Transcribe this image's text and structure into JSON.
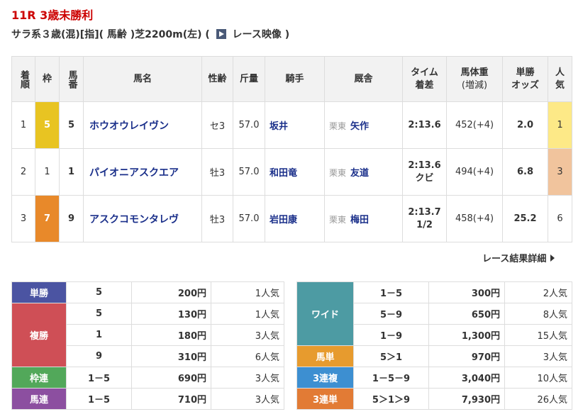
{
  "race": {
    "title": "11R 3歳未勝利",
    "info_prefix": "サラ系３歳(混)[指](",
    "info_weight": "馬齢",
    "info_suffix": ")芝2200m(左)",
    "video_open": "(",
    "video_label": "レース映像",
    "video_close": ")"
  },
  "results_table": {
    "headers": {
      "rank": "着順",
      "frame": "枠",
      "horse_no": "馬番",
      "name": "馬名",
      "sex_age": "性齢",
      "weight": "斤量",
      "jockey": "騎手",
      "trainer": "厩舎",
      "time_line1": "タイム",
      "time_line2": "着差",
      "body_line1": "馬体重",
      "body_line2": "(増減)",
      "odds_line1": "単勝",
      "odds_line2": "オッズ",
      "pop_line1": "人",
      "pop_line2": "気"
    },
    "rows": [
      {
        "rank": "1",
        "frame": "5",
        "horse_no": "5",
        "name": "ホウオウレイヴン",
        "sex_age": "セ3",
        "weight": "57.0",
        "jockey": "坂井",
        "area": "栗東",
        "trainer": "矢作",
        "time": "2:13.6",
        "margin": "",
        "body": "452(+4)",
        "odds": "2.0",
        "pop": "1"
      },
      {
        "rank": "2",
        "frame": "1",
        "horse_no": "1",
        "name": "パイオニアスクエア",
        "sex_age": "牡3",
        "weight": "57.0",
        "jockey": "和田竜",
        "area": "栗東",
        "trainer": "友道",
        "time": "2:13.6",
        "margin": "クビ",
        "body": "494(+4)",
        "odds": "6.8",
        "pop": "3"
      },
      {
        "rank": "3",
        "frame": "7",
        "horse_no": "9",
        "name": "アスクコモンタレヴ",
        "sex_age": "牡3",
        "weight": "57.0",
        "jockey": "岩田康",
        "area": "栗東",
        "trainer": "梅田",
        "time": "2:13.7",
        "margin": "1/2",
        "body": "458(+4)",
        "odds": "25.2",
        "pop": "6"
      }
    ]
  },
  "detail_link": "レース結果詳細",
  "payouts_left": {
    "win": {
      "label": "単勝",
      "rows": [
        {
          "comb": "5",
          "amount": "200円",
          "pop": "1人気"
        }
      ]
    },
    "place": {
      "label": "複勝",
      "rows": [
        {
          "comb": "5",
          "amount": "130円",
          "pop": "1人気"
        },
        {
          "comb": "1",
          "amount": "180円",
          "pop": "3人気"
        },
        {
          "comb": "9",
          "amount": "310円",
          "pop": "6人気"
        }
      ]
    },
    "bracket": {
      "label": "枠連",
      "rows": [
        {
          "comb": "1－5",
          "amount": "690円",
          "pop": "3人気"
        }
      ]
    },
    "quinella": {
      "label": "馬連",
      "rows": [
        {
          "comb": "1－5",
          "amount": "710円",
          "pop": "3人気"
        }
      ]
    }
  },
  "payouts_right": {
    "wide": {
      "label": "ワイド",
      "rows": [
        {
          "comb": "1－5",
          "amount": "300円",
          "pop": "2人気"
        },
        {
          "comb": "5－9",
          "amount": "650円",
          "pop": "8人気"
        },
        {
          "comb": "1－9",
          "amount": "1,300円",
          "pop": "15人気"
        }
      ]
    },
    "exacta": {
      "label": "馬単",
      "rows": [
        {
          "comb": "5＞1",
          "amount": "970円",
          "pop": "3人気"
        }
      ]
    },
    "trio": {
      "label": "3連複",
      "rows": [
        {
          "comb": "1－5－9",
          "amount": "3,040円",
          "pop": "10人気"
        }
      ]
    },
    "trifecta": {
      "label": "3連単",
      "rows": [
        {
          "comb": "5＞1＞9",
          "amount": "7,930円",
          "pop": "26人気"
        }
      ]
    }
  },
  "colors": {
    "title_red": "#cc0000",
    "link_blue": "#1a2f8a",
    "win": "#4b54a2",
    "place": "#cf4f56",
    "bracket": "#52a85a",
    "quinella": "#8c4fa0",
    "wide": "#4d9ba3",
    "exacta": "#e79b2e",
    "trio": "#3d8fd1",
    "trifecta": "#e27b35",
    "frame5": "#e8c422",
    "frame7": "#e8892a",
    "pop1": "#fde987",
    "pop3": "#f1c49d"
  },
  "icons": {
    "video": "play-video-icon",
    "arrow": "chevron-right-icon"
  }
}
